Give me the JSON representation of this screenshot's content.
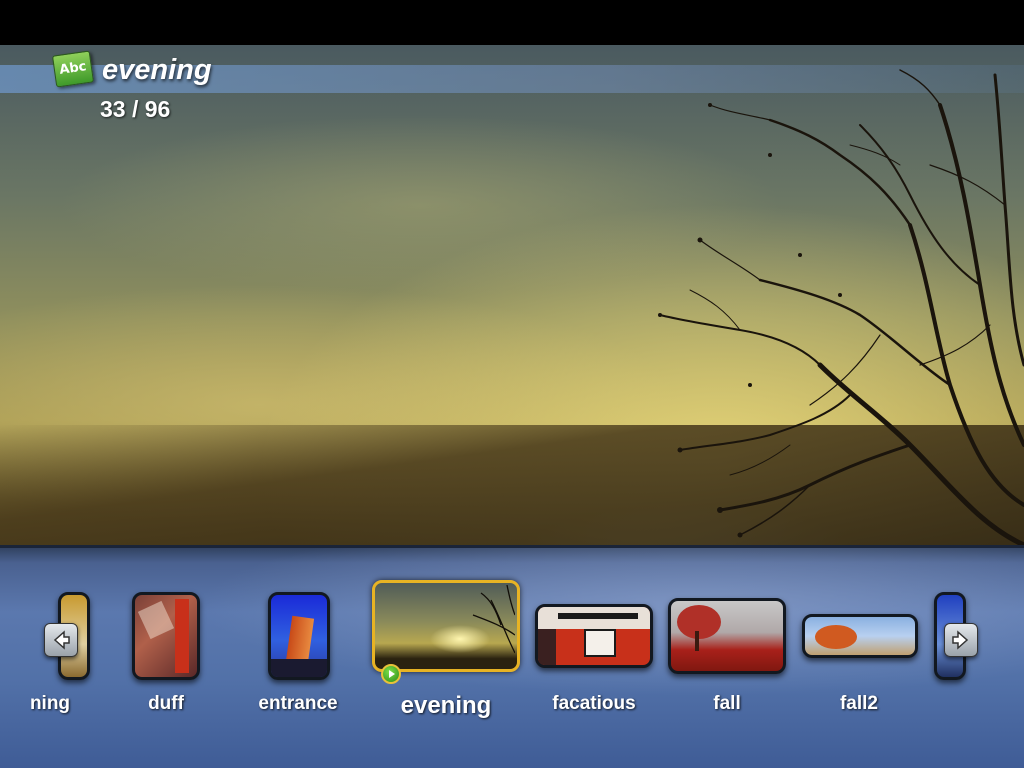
{
  "header": {
    "icon_name": "abc-text-icon",
    "icon_text": "Abc",
    "title": "evening",
    "counter": "33 / 96"
  },
  "thumbnails": [
    {
      "label": "ning",
      "name": "partial",
      "selected": false
    },
    {
      "label": "duff",
      "name": "duff",
      "selected": false
    },
    {
      "label": "entrance",
      "name": "entrance",
      "selected": false
    },
    {
      "label": "evening",
      "name": "evening",
      "selected": true
    },
    {
      "label": "facatious",
      "name": "facatious",
      "selected": false
    },
    {
      "label": "fall",
      "name": "fall",
      "selected": false
    },
    {
      "label": "fall2",
      "name": "fall2",
      "selected": false
    }
  ],
  "nav": {
    "prev_icon": "arrow-left-icon",
    "next_icon": "arrow-right-icon",
    "play_icon": "play-icon"
  },
  "colors": {
    "selected_border": "#e7b324",
    "strip_blue": "#5271a8"
  }
}
